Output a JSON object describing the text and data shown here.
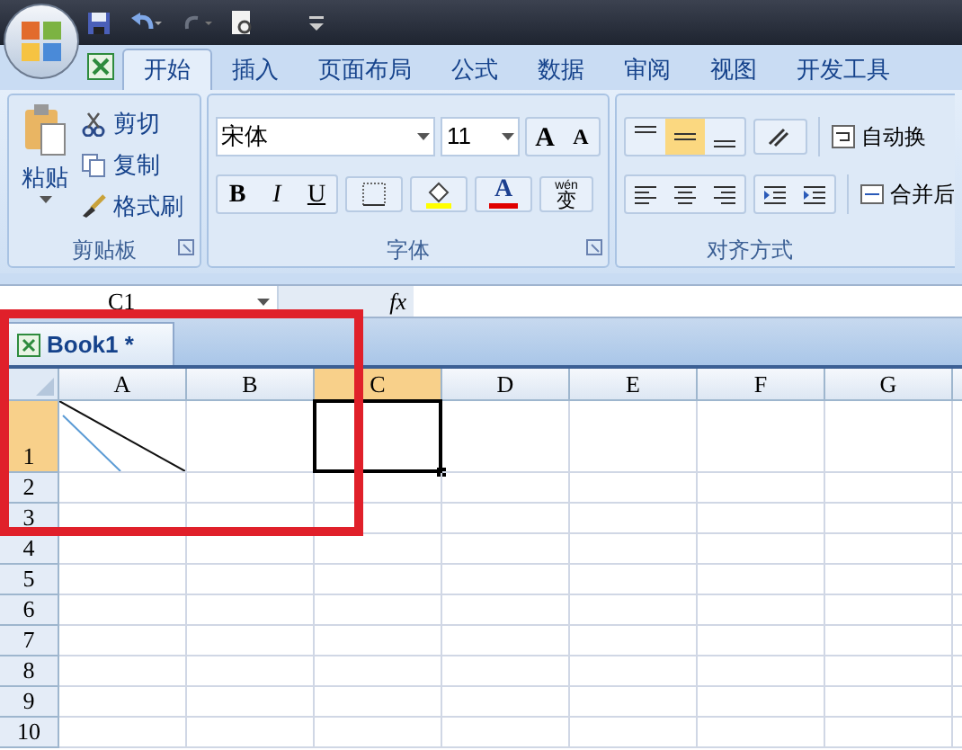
{
  "tabs": [
    {
      "label": "开始",
      "selected": true
    },
    {
      "label": "插入",
      "selected": false
    },
    {
      "label": "页面布局",
      "selected": false
    },
    {
      "label": "公式",
      "selected": false
    },
    {
      "label": "数据",
      "selected": false
    },
    {
      "label": "审阅",
      "selected": false
    },
    {
      "label": "视图",
      "selected": false
    },
    {
      "label": "开发工具",
      "selected": false
    }
  ],
  "ribbon": {
    "clipboard": {
      "paste": "粘贴",
      "actions": [
        "剪切",
        "复制",
        "格式刷"
      ],
      "title": "剪贴板"
    },
    "font": {
      "font_name": "宋体",
      "font_size": "11",
      "size_buttons": [
        "A",
        "A"
      ],
      "style_buttons": [
        "B",
        "I",
        "U"
      ],
      "font_color_letter": "A",
      "phonetic": [
        "wén",
        "变"
      ],
      "title": "字体"
    },
    "alignment": {
      "vertical_align": [
        {
          "selected": false
        },
        {
          "selected": true
        },
        {
          "selected": false
        }
      ],
      "wrap_text": "自动换",
      "merge_center": "合并后",
      "title": "对齐方式"
    }
  },
  "name_box": "C1",
  "formula_label": "fx",
  "workbook_tab": {
    "label": "Book1 *"
  },
  "sheet": {
    "columns": [
      {
        "label": "A",
        "selected": false
      },
      {
        "label": "B",
        "selected": false
      },
      {
        "label": "C",
        "selected": true
      },
      {
        "label": "D",
        "selected": false
      },
      {
        "label": "E",
        "selected": false
      },
      {
        "label": "F",
        "selected": false
      },
      {
        "label": "G",
        "selected": false
      }
    ],
    "rows": [
      {
        "label": "1",
        "selected": true
      },
      {
        "label": "2",
        "selected": false
      },
      {
        "label": "3",
        "selected": false
      },
      {
        "label": "4",
        "selected": false
      },
      {
        "label": "5",
        "selected": false
      },
      {
        "label": "6",
        "selected": false
      },
      {
        "label": "7",
        "selected": false
      },
      {
        "label": "8",
        "selected": false
      },
      {
        "label": "9",
        "selected": false
      },
      {
        "label": "10",
        "selected": false
      }
    ],
    "a1_diagonal": true
  }
}
